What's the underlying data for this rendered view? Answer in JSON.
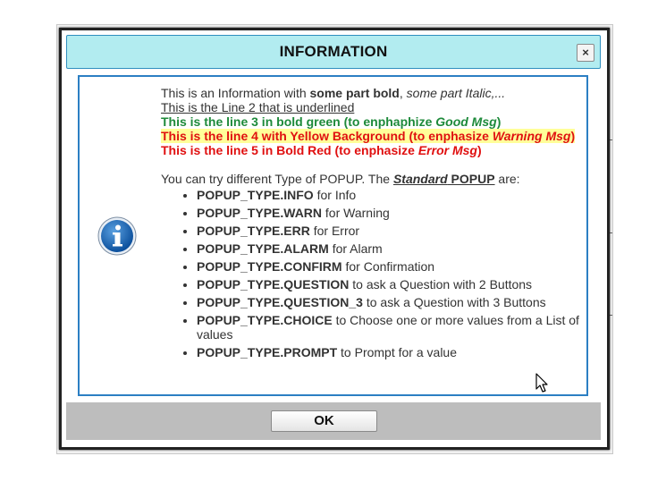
{
  "dialog": {
    "title": "INFORMATION",
    "close_symbol": "×",
    "ok_label": "OK",
    "icon": "info-icon",
    "colors": {
      "title_bg": "#b2ecf0",
      "content_border": "#2c7fc3",
      "good": "#1d8a3a",
      "warning_bg": "#ffff99",
      "error": "#e01010",
      "button_bar": "#bdbdbd"
    }
  },
  "message": {
    "line1": {
      "prefix": "This is an Information with ",
      "bold": "some part bold",
      "comma": ", ",
      "italic": "some part Italic,..."
    },
    "line2": "This is the Line 2 that is underlined",
    "line3": {
      "text": "This is the line 3 in bold green (to enphaphize ",
      "italic": "Good Msg",
      "end": ")"
    },
    "line4": {
      "text": "This is the line 4 with Yellow Background (to enphasize ",
      "italic": "Warning Msg",
      "end": ")"
    },
    "line5": {
      "text": "This is the line 5 in Bold Red (to enphasize ",
      "italic": "Error Msg",
      "end": ")"
    },
    "intro": {
      "text": "You can try different Type of POPUP. The ",
      "standard": "Standard",
      "popup": " POPUP",
      "end": " are:"
    },
    "types": [
      {
        "name": "POPUP_TYPE.INFO",
        "desc": " for Info"
      },
      {
        "name": "POPUP_TYPE.WARN",
        "desc": " for Warning"
      },
      {
        "name": "POPUP_TYPE.ERR",
        "desc": " for Error"
      },
      {
        "name": "POPUP_TYPE.ALARM",
        "desc": " for Alarm"
      },
      {
        "name": "POPUP_TYPE.CONFIRM",
        "desc": " for Confirmation"
      },
      {
        "name": "POPUP_TYPE.QUESTION",
        "desc": " to ask a Question with 2 Buttons"
      },
      {
        "name": "POPUP_TYPE.QUESTION_3",
        "desc": " to ask a Question with 3 Buttons"
      },
      {
        "name": "POPUP_TYPE.CHOICE",
        "desc": " to Choose one or more values from a List of values"
      },
      {
        "name": "POPUP_TYPE.PROMPT",
        "desc": " to Prompt for a value"
      }
    ]
  }
}
